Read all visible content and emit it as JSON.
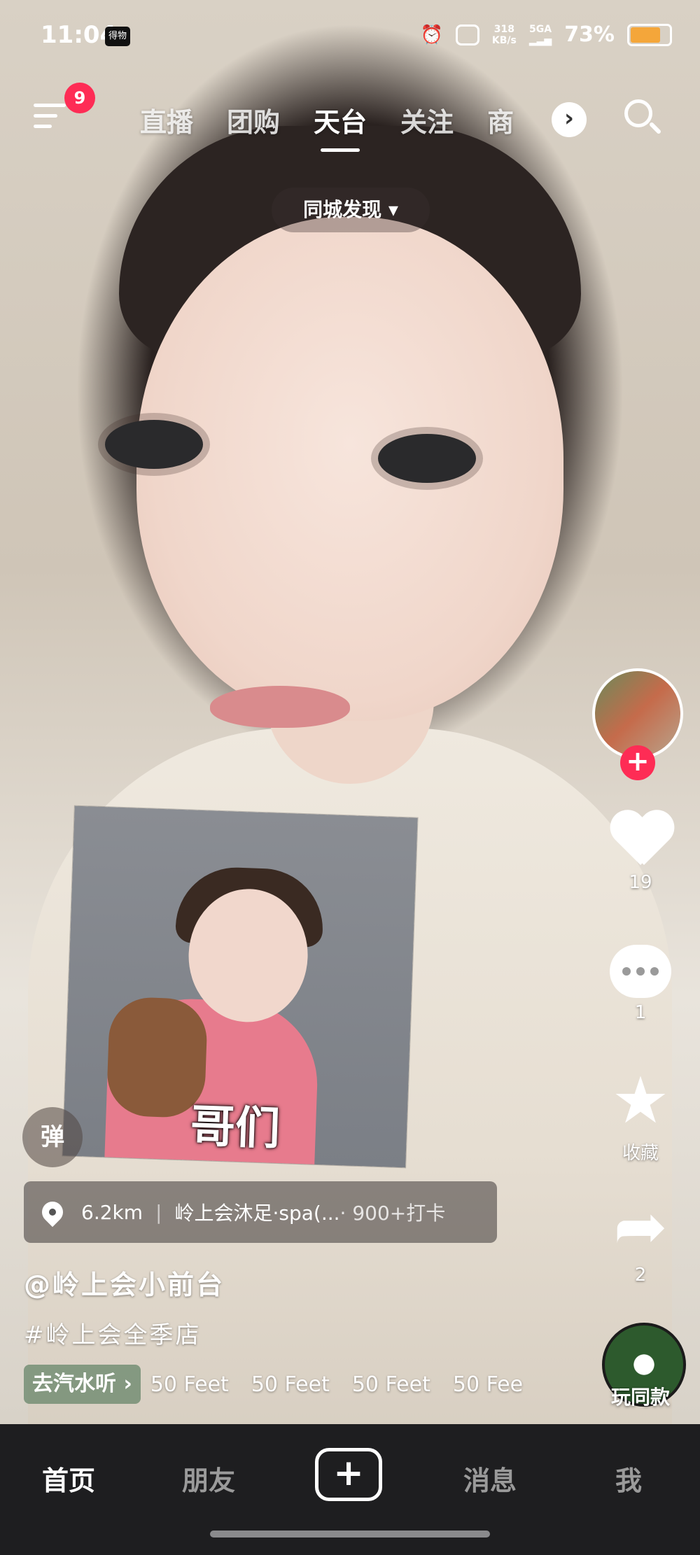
{
  "status_bar": {
    "time": "11:04",
    "app_logo_text": "得物",
    "net_speed_value": "318",
    "net_speed_unit": "KB/s",
    "signal": "5GA",
    "battery": "73%",
    "battery_level": 0.73
  },
  "top_nav": {
    "menu_badge": "9",
    "tabs": [
      {
        "label": "直播"
      },
      {
        "label": "团购"
      },
      {
        "label": "天台"
      },
      {
        "label": "关注"
      },
      {
        "label": "商"
      }
    ],
    "active_tab": "天台",
    "more_symbol": "›"
  },
  "city_filter": {
    "label": "同城发现 ▾"
  },
  "sticker": {
    "caption": "哥们"
  },
  "side_rail": {
    "follow_symbol": "+",
    "like_count": "19",
    "comment_count": "1",
    "favorite_label": "收藏",
    "share_count": "2",
    "record_label": "玩同款"
  },
  "danmu": {
    "label": "弹"
  },
  "location": {
    "distance": "6.2km",
    "place": "岭上会沐足·spa(...",
    "checkins": "· 900+打卡"
  },
  "post": {
    "author": "@岭上会小前台",
    "hashtag": "#岭上会全季店"
  },
  "music": {
    "tag": "去汽水听 ›",
    "tracks": [
      "50 Feet",
      "50 Feet",
      "50 Feet",
      "50 Fee"
    ]
  },
  "bottom_nav": {
    "home": "首页",
    "friends": "朋友",
    "create_symbol": "+",
    "messages": "消息",
    "me": "我"
  },
  "colors": {
    "accent": "#fe2c55",
    "battery": "#f4a63a",
    "bottom_bar": "#1e1e20"
  }
}
